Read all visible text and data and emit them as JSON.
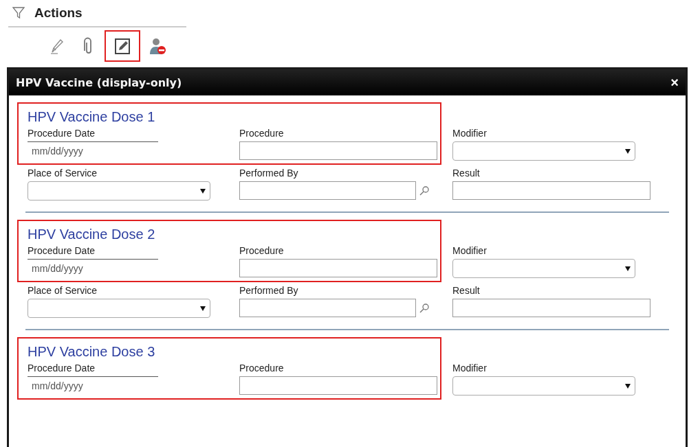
{
  "actions": {
    "title": "Actions",
    "tools": [
      {
        "kind": "pencil",
        "selected": false
      },
      {
        "kind": "paperclip",
        "selected": false
      },
      {
        "kind": "edit",
        "selected": true
      },
      {
        "kind": "user-remove",
        "selected": false
      }
    ]
  },
  "dialog": {
    "title": "HPV Vaccine (display-only)",
    "close": "×",
    "sections": [
      {
        "title": "HPV Vaccine Dose 1",
        "highlighted": true,
        "fields": [
          {
            "kind": "date",
            "label": "Procedure Date",
            "placeholder": "mm/dd/yyyy"
          },
          {
            "kind": "text",
            "label": "Procedure"
          },
          {
            "kind": "select",
            "label": "Modifier"
          },
          {
            "kind": "select",
            "label": "Place of Service"
          },
          {
            "kind": "lookup",
            "label": "Performed By"
          },
          {
            "kind": "text",
            "label": "Result"
          }
        ]
      },
      {
        "title": "HPV Vaccine Dose 2",
        "highlighted": true,
        "fields": [
          {
            "kind": "date",
            "label": "Procedure Date",
            "placeholder": "mm/dd/yyyy"
          },
          {
            "kind": "text",
            "label": "Procedure"
          },
          {
            "kind": "select",
            "label": "Modifier"
          },
          {
            "kind": "select",
            "label": "Place of Service"
          },
          {
            "kind": "lookup",
            "label": "Performed By"
          },
          {
            "kind": "text",
            "label": "Result"
          }
        ]
      },
      {
        "title": "HPV Vaccine Dose 3",
        "highlighted": true,
        "fields": [
          {
            "kind": "date",
            "label": "Procedure Date",
            "placeholder": "mm/dd/yyyy"
          },
          {
            "kind": "text",
            "label": "Procedure"
          },
          {
            "kind": "select",
            "label": "Modifier"
          }
        ]
      }
    ]
  }
}
